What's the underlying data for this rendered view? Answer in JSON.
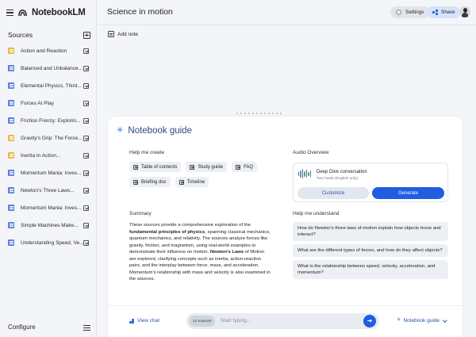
{
  "app": {
    "name": "NotebookLM"
  },
  "sidebar": {
    "sources_label": "Sources",
    "configure_label": "Configure",
    "items": [
      {
        "label": "Action and Reaction",
        "icon": "doc-icon",
        "color": "yellow",
        "checked": true
      },
      {
        "label": "Balanced and Unbalance...",
        "icon": "doc-icon",
        "color": "blue",
        "checked": true
      },
      {
        "label": "Elemental Physics, Third...",
        "icon": "doc-icon",
        "color": "blue",
        "checked": true
      },
      {
        "label": "Forces At Play",
        "icon": "doc-icon",
        "color": "blue",
        "checked": true
      },
      {
        "label": "Friction Frenzy: Explorin...",
        "icon": "doc-icon",
        "color": "blue",
        "checked": true
      },
      {
        "label": "Gravity's Grip: The Force...",
        "icon": "doc-icon",
        "color": "yellow",
        "checked": true
      },
      {
        "label": "Inertia In Action...",
        "icon": "doc-icon",
        "color": "yellow",
        "checked": true
      },
      {
        "label": "Momentum Mania: Inves...",
        "icon": "doc-icon",
        "color": "blue",
        "checked": true
      },
      {
        "label": "Newton's Three Laws...",
        "icon": "doc-icon",
        "color": "blue",
        "checked": true
      },
      {
        "label": "Momentum Mania: Inves...",
        "icon": "doc-icon",
        "color": "blue",
        "checked": true
      },
      {
        "label": "Simple Machines Make...",
        "icon": "doc-icon",
        "color": "blue",
        "checked": true
      },
      {
        "label": "Understanding Speed, Ve...",
        "icon": "doc-icon",
        "color": "blue",
        "checked": true
      }
    ]
  },
  "header": {
    "notebook_title": "Science in motion",
    "settings_label": "Settings",
    "share_label": "Share"
  },
  "main": {
    "add_note_label": "Add note"
  },
  "guide": {
    "title": "Notebook guide",
    "help_create_label": "Help me create",
    "create_options": [
      "Table of contents",
      "Study guide",
      "FAQ",
      "Briefing doc",
      "Timeline"
    ],
    "audio_overview_label": "Audio Overview",
    "audio_title": "Deep Dive conversation",
    "audio_subtitle": "Two hosts (English only)",
    "customize_label": "Customize",
    "generate_label": "Generate",
    "summary_label": "Summary",
    "summary": {
      "p1": "These sources provide a comprehensive exploration of the ",
      "b1": "fundamental principles of physics",
      "p2": ", spanning classical mechanics, quantum mechanics, and relativity. The sources analyze forces like gravity, friction, and magnetism, using real-world examples to demonstrate their influence on motion. ",
      "b2": "Newton's Laws",
      "p3": " of Motion are explored, clarifying concepts such as inertia, action-reaction pairs, and the interplay between force, mass, and acceleration. Momentum's relationship with mass and velocity is also examined in the sources."
    },
    "help_understand_label": "Help me understand",
    "questions": [
      "How do Newton's three laws of motion explain how objects move and interact?",
      "What are the different types of forces, and how do they affect objects?",
      "What is the relationship between speed, velocity, acceleration, and momentum?"
    ]
  },
  "footer": {
    "view_chat_label": "View chat",
    "sources_count": "12 sources",
    "input_placeholder": "Start typing...",
    "notebook_guide_label": "Notebook guide"
  },
  "colors": {
    "accent": "#1f5ee0",
    "title_blue": "#2b4a86",
    "background": "#f3f5f9"
  }
}
